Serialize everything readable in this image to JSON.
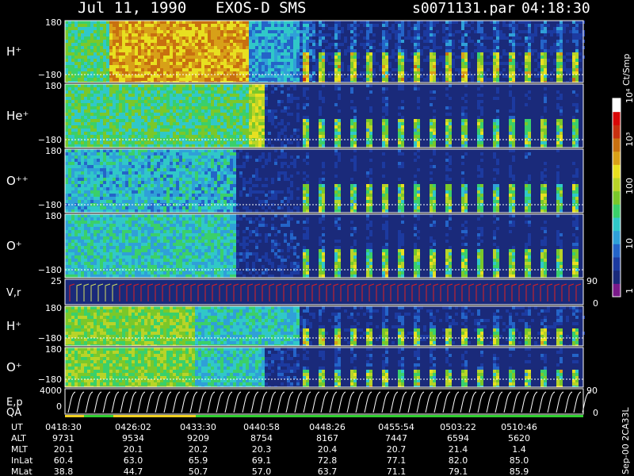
{
  "header": {
    "date": "Jul 11, 1990",
    "instrument": "EXOS-D SMS",
    "file": "s0071131.par",
    "time": "04:18:30"
  },
  "colorbar": {
    "unit_label": "Ct/Smp",
    "tick_labels": [
      "1",
      "10",
      "100",
      "10³",
      "10⁴"
    ]
  },
  "footer": {
    "stamp": "Sep-00 2CA33L"
  },
  "ephemeris": {
    "row_labels": [
      "UT",
      "ALT",
      "MLT",
      "InLat",
      "MLat"
    ],
    "columns": [
      {
        "UT": "0418:30",
        "ALT": "9731",
        "MLT": "20.1",
        "InLat": "60.4",
        "MLat": "38.8"
      },
      {
        "UT": "0426:02",
        "ALT": "9534",
        "MLT": "20.1",
        "InLat": "63.0",
        "MLat": "44.7"
      },
      {
        "UT": "0433:30",
        "ALT": "9209",
        "MLT": "20.2",
        "InLat": "65.9",
        "MLat": "50.7"
      },
      {
        "UT": "0440:58",
        "ALT": "8754",
        "MLT": "20.3",
        "InLat": "69.1",
        "MLat": "57.0"
      },
      {
        "UT": "0448:26",
        "ALT": "8167",
        "MLT": "20.4",
        "InLat": "72.8",
        "MLat": "63.7"
      },
      {
        "UT": "0455:54",
        "ALT": "7447",
        "MLT": "20.7",
        "InLat": "77.1",
        "MLat": "71.1"
      },
      {
        "UT": "0503:22",
        "ALT": "6594",
        "MLT": "21.4",
        "InLat": "82.0",
        "MLat": "79.1"
      },
      {
        "UT": "0510:46",
        "ALT": "5620",
        "MLT": "1.4",
        "InLat": "85.0",
        "MLat": "85.9"
      }
    ]
  },
  "chart_data": {
    "type": "heatmap",
    "colorbar": {
      "unit": "Ct/Smp",
      "scale": "log",
      "range": [
        1,
        10000
      ],
      "colors": [
        "#7a1a8a",
        "#1a2a7a",
        "#1c3aa0",
        "#2464c8",
        "#2fa0d8",
        "#30c8c8",
        "#3ad06a",
        "#7ac82a",
        "#b8d428",
        "#e8e020",
        "#d8a018",
        "#c87010",
        "#c83010",
        "#d80808",
        "#ffffff"
      ]
    },
    "panels": [
      {
        "label": "H⁺",
        "ymax": "180",
        "ymin": "−180",
        "kind": "spectrogram",
        "profile": "h1"
      },
      {
        "label": "He⁺",
        "ymax": "180",
        "ymin": "−180",
        "kind": "spectrogram",
        "profile": "he"
      },
      {
        "label": "O⁺⁺",
        "ymax": "180",
        "ymin": "−180",
        "kind": "spectrogram",
        "profile": "opp"
      },
      {
        "label": "O⁺",
        "ymax": "180",
        "ymin": "−180",
        "kind": "spectrogram",
        "profile": "op1"
      },
      {
        "label": "V,r",
        "ymax": "25",
        "ymin": "",
        "right_top": "90",
        "right_bottom": "0",
        "kind": "lines_red"
      },
      {
        "label": "H⁺",
        "ymax": "180",
        "ymin": "−180",
        "kind": "spectrogram",
        "profile": "h2"
      },
      {
        "label": "O⁺",
        "ymax": "180",
        "ymin": "−180",
        "kind": "spectrogram",
        "profile": "op2"
      },
      {
        "label": "E,p",
        "label2": "QA",
        "ymax": "4000",
        "ymin": "0",
        "right_top": "90",
        "right_bottom": "0",
        "kind": "lines_white"
      }
    ],
    "x_ticks": [
      "0418:30",
      "0426:02",
      "0433:30",
      "0440:58",
      "0448:26",
      "0455:54",
      "0503:22",
      "0510:46"
    ]
  }
}
